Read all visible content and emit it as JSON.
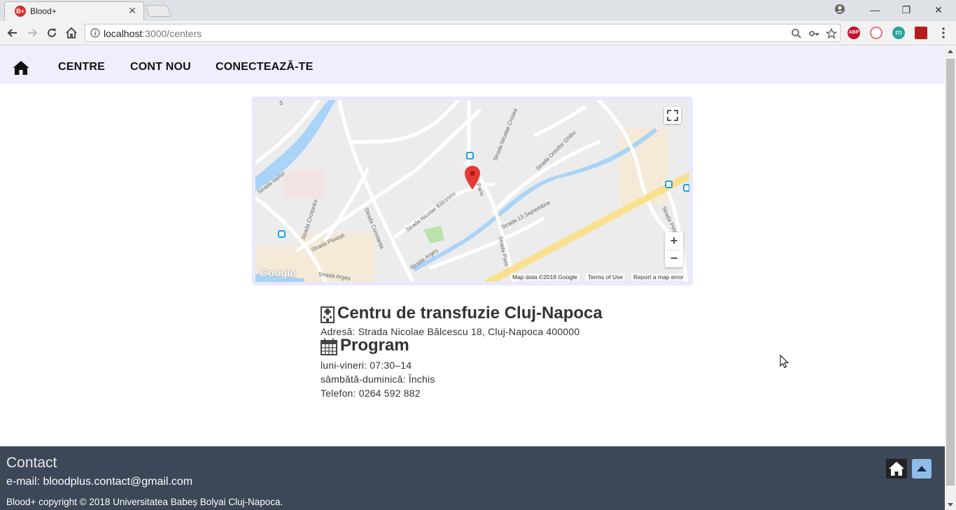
{
  "browser": {
    "tab_title": "Blood+",
    "tab_favicon_text": "B+",
    "url_host": "localhost",
    "url_path": ":3000/centers",
    "extensions": [
      "ABP",
      "",
      "m",
      ""
    ]
  },
  "navbar": {
    "home_icon": "home-icon",
    "links": [
      "CENTRE",
      "CONT NOU",
      "CONECTEAZĂ-TE"
    ]
  },
  "map": {
    "streets": [
      "S",
      "Strada Iașilor",
      "Strada Croitorilor",
      "Strada Ploiești",
      "Strada Constanța",
      "Strada Nicolae Bălcescu",
      "Paris",
      "Strada Nicolae Cristea",
      "Strada Onisifor Ghibu",
      "Strada 13 Septembrie",
      "Strada Paris",
      "Strada Argeș",
      "Strada Argeș",
      "Strada Petofi Sa"
    ],
    "zoom_in": "+",
    "zoom_out": "−",
    "footer": [
      "Map data ©2018 Google",
      "Terms of Use",
      "Report a map error"
    ],
    "logo": "Google",
    "colors": {
      "river": "#a9d3f7",
      "road_major": "#f9e08e",
      "pin": "#e53935"
    }
  },
  "center": {
    "name": "Centru de transfuzie Cluj-Napoca",
    "address": "Adresă: Strada Nicolae Bălcescu 18, Cluj-Napoca 400000",
    "program_title": "Program",
    "hours": [
      "luni-vineri: 07:30–14",
      "sâmbătă-duminică: Închis"
    ],
    "phone": "Telefon: 0264 592 882"
  },
  "footer": {
    "title": "Contact",
    "email": "e-mail: bloodplus.contact@gmail.com",
    "copyright": "Blood+ copyright © 2018 Universitatea Babeș Bolyai Cluj-Napoca.",
    "bg_color": "#3c4757"
  }
}
